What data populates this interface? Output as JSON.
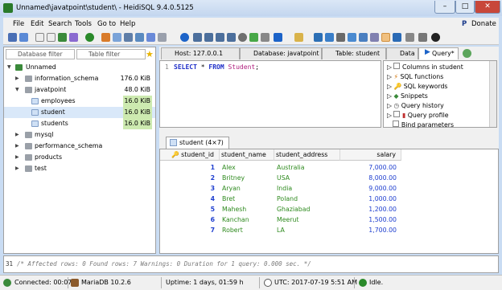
{
  "window": {
    "title": "Unnamed\\javatpoint\\student\\ - HeidiSQL 9.4.0.5125"
  },
  "menu": [
    "File",
    "Edit",
    "Search",
    "Tools",
    "Go to",
    "Help"
  ],
  "donate": "Donate",
  "filters": {
    "database": "Database filter",
    "table": "Table filter"
  },
  "tree": [
    {
      "label": "Unnamed",
      "size": ""
    },
    {
      "label": "information_schema",
      "size": "176.0 KiB"
    },
    {
      "label": "javatpoint",
      "size": "48.0 KiB"
    },
    {
      "label": "employees",
      "size": "16.0 KiB"
    },
    {
      "label": "student",
      "size": "16.0 KiB"
    },
    {
      "label": "students",
      "size": "16.0 KiB"
    },
    {
      "label": "mysql",
      "size": ""
    },
    {
      "label": "performance_schema",
      "size": ""
    },
    {
      "label": "products",
      "size": ""
    },
    {
      "label": "test",
      "size": ""
    }
  ],
  "tabs": [
    "Host: 127.0.0.1",
    "Database: javatpoint",
    "Table: student",
    "Data",
    "Query*"
  ],
  "query": {
    "line": "1",
    "kw1": "SELECT",
    "star": "*",
    "kw2": "FROM",
    "table": "Student",
    "semi": ";"
  },
  "helpers": [
    "Columns in student",
    "SQL functions",
    "SQL keywords",
    "Snippets",
    "Query history",
    "Query profile",
    "Bind parameters"
  ],
  "results_tab": "student (4×7)",
  "columns": [
    "student_id",
    "student_name",
    "student_address",
    "salary"
  ],
  "rows": [
    [
      "1",
      "Alex",
      "Australia",
      "7,000.00"
    ],
    [
      "2",
      "Britney",
      "USA",
      "8,000.00"
    ],
    [
      "3",
      "Aryan",
      "India",
      "9,000.00"
    ],
    [
      "4",
      "Bret",
      "Poland",
      "1,000.00"
    ],
    [
      "5",
      "Mahesh",
      "Ghaziabad",
      "1,200.00"
    ],
    [
      "6",
      "Kanchan",
      "Meerut",
      "1,500.00"
    ],
    [
      "7",
      "Robert",
      "LA",
      "1,700.00"
    ]
  ],
  "log": {
    "line": "31",
    "text": "/* Affected rows: 0  Found rows: 7  Warnings: 0  Duration for 1 query: 0.000 sec. */"
  },
  "status": {
    "connected": "Connected: 00:07",
    "server": "MariaDB 10.2.6",
    "uptime": "Uptime: 1 days, 01:59 h",
    "utc": "UTC: 2017-07-19 5:51 AM",
    "state": "Idle."
  },
  "colors": {
    "id": "#1f3fcf",
    "name": "#2e8a1e",
    "salary": "#1f3fcf",
    "size_highlight": "#cdeab0"
  }
}
